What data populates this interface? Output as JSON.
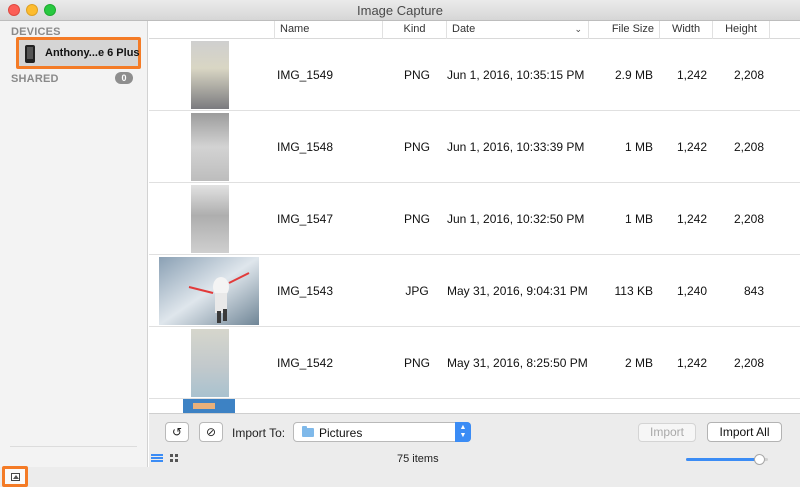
{
  "window": {
    "title": "Image Capture"
  },
  "sidebar": {
    "devices_label": "DEVICES",
    "device_name": "Anthony...e 6 Plus",
    "shared_label": "SHARED",
    "shared_count": "0"
  },
  "table": {
    "columns": {
      "name": "Name",
      "kind": "Kind",
      "date": "Date",
      "file_size": "File Size",
      "width": "Width",
      "height": "Height"
    },
    "rows": [
      {
        "name": "IMG_1549",
        "kind": "PNG",
        "date": "Jun 1, 2016, 10:35:15 PM",
        "file_size": "2.9 MB",
        "width": "1,242",
        "height": "2,208"
      },
      {
        "name": "IMG_1548",
        "kind": "PNG",
        "date": "Jun 1, 2016, 10:33:39 PM",
        "file_size": "1 MB",
        "width": "1,242",
        "height": "2,208"
      },
      {
        "name": "IMG_1547",
        "kind": "PNG",
        "date": "Jun 1, 2016, 10:32:50 PM",
        "file_size": "1 MB",
        "width": "1,242",
        "height": "2,208"
      },
      {
        "name": "IMG_1543",
        "kind": "JPG",
        "date": "May 31, 2016, 9:04:31 PM",
        "file_size": "113 KB",
        "width": "1,240",
        "height": "843"
      },
      {
        "name": "IMG_1542",
        "kind": "PNG",
        "date": "May 31, 2016, 8:25:50 PM",
        "file_size": "2 MB",
        "width": "1,242",
        "height": "2,208"
      }
    ]
  },
  "toolbar": {
    "import_to_label": "Import To:",
    "destination": "Pictures",
    "import_button": "Import",
    "import_all_button": "Import All",
    "item_count": "75 items",
    "thumbnail_size": 0.9
  },
  "colors": {
    "highlight": "#f47b26",
    "accent": "#3b8cf5"
  }
}
